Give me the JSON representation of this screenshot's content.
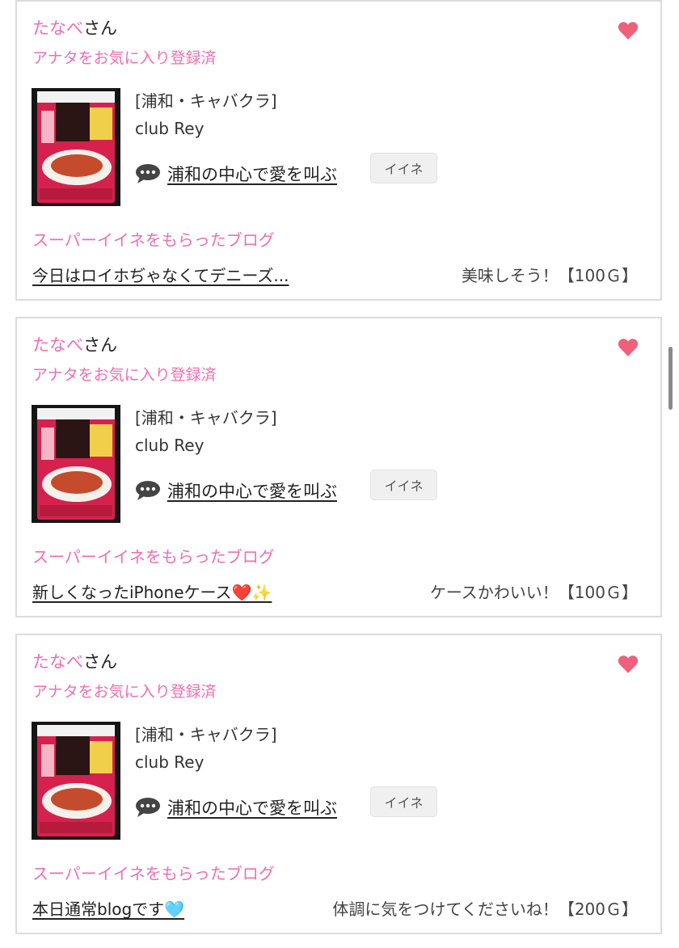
{
  "cards": [
    {
      "user_name": "たなべ",
      "user_suffix": "さん",
      "favorite_status": "アナタをお気に入り登録済",
      "shop_category": "[浦和・キャバクラ]",
      "shop_name": "club Rey",
      "blog_title": "浦和の中心で愛を叫ぶ",
      "like_label": "イイネ",
      "section_label": "スーパーイイネをもらったブログ",
      "post_title": "今日はロイホぢゃなくてデニーズ...",
      "comment": "美味しそう！【100Ｇ】",
      "heart_icon": "heart-icon",
      "chat_icon": "speech-bubble-icon"
    },
    {
      "user_name": "たなべ",
      "user_suffix": "さん",
      "favorite_status": "アナタをお気に入り登録済",
      "shop_category": "[浦和・キャバクラ]",
      "shop_name": "club Rey",
      "blog_title": "浦和の中心で愛を叫ぶ",
      "like_label": "イイネ",
      "section_label": "スーパーイイネをもらったブログ",
      "post_title": "新しくなったiPhoneケース❤️✨",
      "comment": "ケースかわいい！【100Ｇ】",
      "heart_icon": "heart-icon",
      "chat_icon": "speech-bubble-icon"
    },
    {
      "user_name": "たなべ",
      "user_suffix": "さん",
      "favorite_status": "アナタをお気に入り登録済",
      "shop_category": "[浦和・キャバクラ]",
      "shop_name": "club Rey",
      "blog_title": "浦和の中心で愛を叫ぶ",
      "like_label": "イイネ",
      "section_label": "スーパーイイネをもらったブログ",
      "post_title": "本日通常blogです🩵",
      "comment": "体調に気をつけてくださいね！【200Ｇ】",
      "heart_icon": "heart-icon",
      "chat_icon": "speech-bubble-icon"
    }
  ],
  "colors": {
    "accent_pink": "#ec6fb3",
    "heart": "#f0607a",
    "card_border": "#dcdcdc"
  }
}
